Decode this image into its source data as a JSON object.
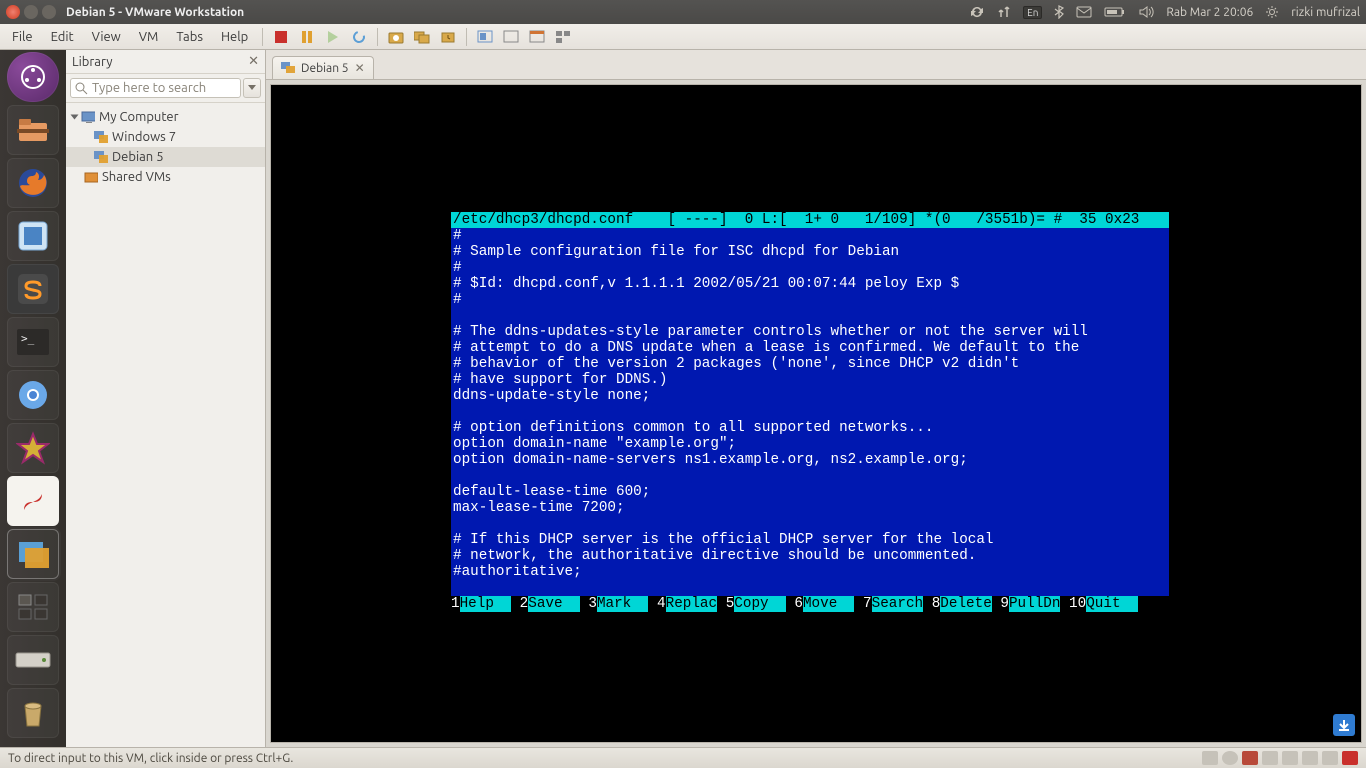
{
  "sysbar": {
    "title": "Debian 5 - VMware Workstation",
    "lang": "En",
    "clock": "Rab Mar  2 20:06",
    "user": "rizki mufrizal"
  },
  "menubar": {
    "items": [
      "File",
      "Edit",
      "View",
      "VM",
      "Tabs",
      "Help"
    ]
  },
  "library": {
    "title": "Library",
    "search_placeholder": "Type here to search",
    "nodes": {
      "root": "My Computer",
      "children": [
        "Windows 7",
        "Debian 5"
      ],
      "shared": "Shared VMs"
    }
  },
  "tab": {
    "label": "Debian 5"
  },
  "console": {
    "status": "/etc/dhcp3/dhcpd.conf    [ ----]  0 L:[  1+ 0   1/109] *(0   /3551b)= #  35 0x23",
    "lines": [
      "#",
      "# Sample configuration file for ISC dhcpd for Debian",
      "#",
      "# $Id: dhcpd.conf,v 1.1.1.1 2002/05/21 00:07:44 peloy Exp $",
      "#",
      "",
      "# The ddns-updates-style parameter controls whether or not the server will",
      "# attempt to do a DNS update when a lease is confirmed. We default to the",
      "# behavior of the version 2 packages ('none', since DHCP v2 didn't",
      "# have support for DDNS.)",
      "ddns-update-style none;",
      "",
      "# option definitions common to all supported networks...",
      "option domain-name \"example.org\";",
      "option domain-name-servers ns1.example.org, ns2.example.org;",
      "",
      "default-lease-time 600;",
      "max-lease-time 7200;",
      "",
      "# If this DHCP server is the official DHCP server for the local",
      "# network, the authoritative directive should be uncommented.",
      "#authoritative;",
      ""
    ],
    "fkeys": [
      {
        "n": "1",
        "l": "Help  "
      },
      {
        "n": "2",
        "l": "Save  "
      },
      {
        "n": "3",
        "l": "Mark  "
      },
      {
        "n": "4",
        "l": "Replac"
      },
      {
        "n": "5",
        "l": "Copy  "
      },
      {
        "n": "6",
        "l": "Move  "
      },
      {
        "n": "7",
        "l": "Search"
      },
      {
        "n": "8",
        "l": "Delete"
      },
      {
        "n": "9",
        "l": "PullDn"
      },
      {
        "n": "10",
        "l": "Quit  "
      }
    ]
  },
  "statusbar": {
    "text": "To direct input to this VM, click inside or press Ctrl+G."
  },
  "launcher": {
    "items": [
      "dash",
      "files",
      "firefox",
      "virtualbox",
      "sublime",
      "terminal",
      "chromium",
      "star",
      "pdf",
      "vmware",
      "workspace",
      "disk",
      "trash"
    ]
  }
}
